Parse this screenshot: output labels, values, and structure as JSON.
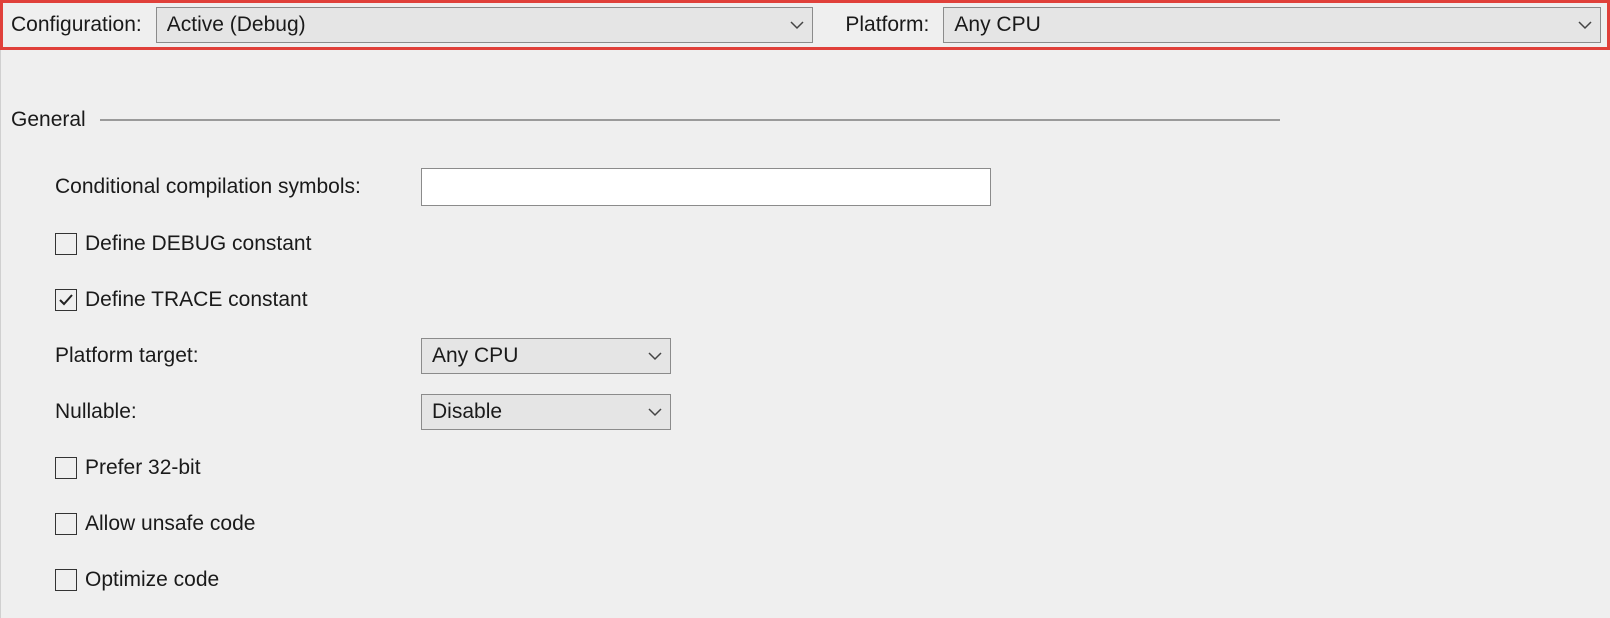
{
  "topbar": {
    "configuration_label": "Configuration:",
    "configuration_value": "Active (Debug)",
    "platform_label": "Platform:",
    "platform_value": "Any CPU"
  },
  "section": {
    "title": "General"
  },
  "fields": {
    "conditional_symbols_label": "Conditional compilation symbols:",
    "conditional_symbols_value": "",
    "define_debug_label": "Define DEBUG constant",
    "define_debug_checked": false,
    "define_trace_label": "Define TRACE constant",
    "define_trace_checked": true,
    "platform_target_label": "Platform target:",
    "platform_target_value": "Any CPU",
    "nullable_label": "Nullable:",
    "nullable_value": "Disable",
    "prefer_32bit_label": "Prefer 32-bit",
    "prefer_32bit_checked": false,
    "allow_unsafe_label": "Allow unsafe code",
    "allow_unsafe_checked": false,
    "optimize_label": "Optimize code",
    "optimize_checked": false
  }
}
